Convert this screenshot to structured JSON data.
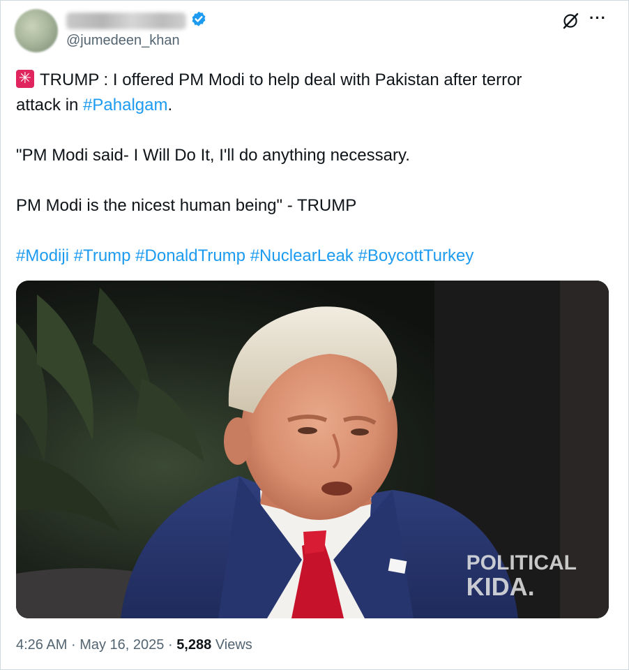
{
  "author": {
    "handle": "@jumedeen_khan",
    "verified_icon": "verified-badge-icon"
  },
  "header_actions": {
    "grok_icon": "grok-icon",
    "more_icon": "more-dots-icon",
    "more_label": "···"
  },
  "tweet": {
    "siren_icon": "rotating-light-emoji",
    "line1_text": "TRUMP : I offered PM Modi to help deal with Pakistan after terror",
    "line2_text": "attack in ",
    "line2_tag": "#Pahalgam",
    "line2_end": ".",
    "line3_text": "\"PM Modi said- I Will Do It, I'll do anything necessary.",
    "line4_text": "PM Modi is the nicest human being\" - TRUMP",
    "hashtags": [
      "#Modiji",
      "#Trump",
      "#DonaldTrump",
      "#NuclearLeak",
      "#BoycottTurkey"
    ]
  },
  "media": {
    "type": "video",
    "watermark_line1": "POLITICAL",
    "watermark_line2": "KIDA."
  },
  "footer": {
    "time": "4:26 AM",
    "separator": "·",
    "date": "May 16, 2025",
    "views_count": "5,288",
    "views_label": "Views"
  },
  "colors": {
    "link": "#1d9bf0",
    "secondary_text": "#536471",
    "primary_text": "#0f1419",
    "border": "#cfd9de",
    "siren": "#e0245e"
  }
}
